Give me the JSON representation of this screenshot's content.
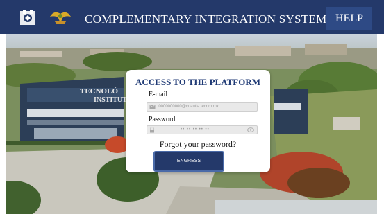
{
  "header": {
    "title": "COMPLEMENTARY INTEGRATION SYSTEM",
    "help_label": "HELP",
    "logo_left": "institution-seal-logo",
    "logo_right": "eagle-emblem-logo"
  },
  "background": {
    "sign_line1": "TECNOLÓ",
    "sign_line2": "INSTITUT"
  },
  "login": {
    "title": "ACCESS TO THE PLATFORM",
    "email_label": "E-mail",
    "email_value": "l0000000000@cuautla.tecnm.mx",
    "password_label": "Password",
    "password_value": "•• •• •• •• ••",
    "forgot_label": "Forgot your password?",
    "submit_label": "ENGRESS"
  },
  "colors": {
    "header_bg": "#24396a",
    "help_bg": "#2e4a85",
    "title_blue": "#1f3a75",
    "button_bg": "#24396a"
  }
}
